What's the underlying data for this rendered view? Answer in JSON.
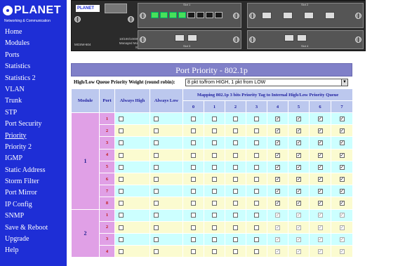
{
  "logo": {
    "name": "PLANET",
    "tagline": "Networking & Communication"
  },
  "menu": [
    "Home",
    "Modules",
    "Ports",
    "Statistics",
    "Statistics 2",
    "VLAN",
    "Trunk",
    "STP",
    "Port Security",
    "Priority",
    "Priority 2",
    "IGMP",
    "Static Address",
    "Storm Filter",
    "Port Mirror",
    "IP Config",
    "SNMP",
    "Save & Reboot",
    "Upgrade",
    "Help"
  ],
  "active_menu": "Priority",
  "device": {
    "brand": "PLANET",
    "model": "MGSW-604",
    "description": "10/100/1000Mbps Managed Modular Switch",
    "slot1": "Slot 1",
    "slot2": "Slot 2",
    "slot3": "Slot 3",
    "slot4": "Slot 4"
  },
  "page_title": "Port Priority - 802.1p",
  "weight": {
    "label": "High/Low Queue Priority Weight (round robin):",
    "value": "8 pkt to/from HIGH, 1 pkt from LOW"
  },
  "table": {
    "col_module": "Module",
    "col_port": "Port",
    "col_always_high": "Always High",
    "col_always_low": "Always Low",
    "mapping_header": "Mapping 802.1p 3 bits Priority Tag to Internal High/Low Priority Queue",
    "tags": [
      "0",
      "1",
      "2",
      "3",
      "4",
      "5",
      "6",
      "7"
    ]
  },
  "modules": [
    {
      "module": "1",
      "ports": [
        "1",
        "2",
        "3",
        "4",
        "5",
        "6",
        "7",
        "8"
      ]
    },
    {
      "module": "2",
      "ports": [
        "1",
        "2",
        "3",
        "4"
      ]
    }
  ],
  "mapping_default": [
    false,
    false,
    false,
    false,
    true,
    true,
    true,
    true
  ]
}
